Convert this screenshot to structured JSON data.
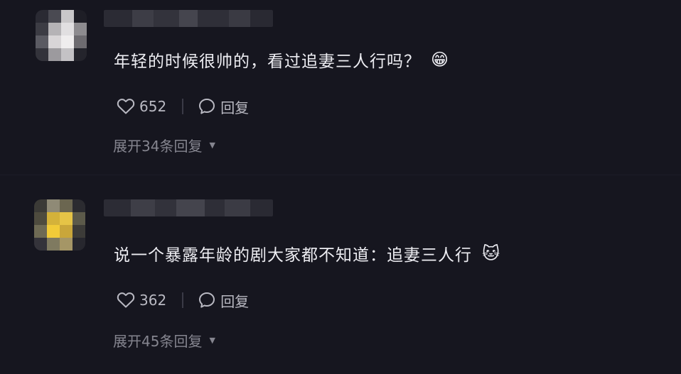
{
  "comments": [
    {
      "text": "年轻的时候很帅的，看过追妻三人行吗？",
      "emoji": "😁",
      "emoji_name": "grinning-face",
      "likes": "652",
      "reply_label": "回复",
      "expand_label": "展开34条回复"
    },
    {
      "text": "说一个暴露年龄的剧大家都不知道：追妻三人行",
      "emoji": "🐱",
      "emoji_name": "cat-face",
      "likes": "362",
      "reply_label": "回复",
      "expand_label": "展开45条回复"
    }
  ],
  "icons": {
    "like": "heart-icon",
    "reply": "speech-bubble-icon",
    "expand": "caret-down-icon"
  },
  "colors": {
    "background": "#16161f",
    "text": "#ededf2",
    "action": "#b9b9c2",
    "muted": "#85858f"
  }
}
